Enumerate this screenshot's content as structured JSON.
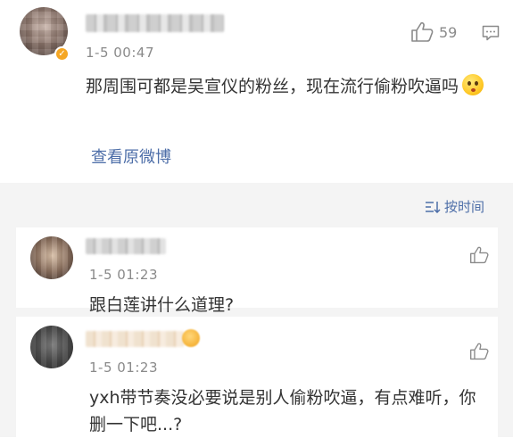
{
  "main_comment": {
    "time": "1-5 00:47",
    "like_count": "59",
    "content": "那周围可都是吴宣仪的粉丝，现在流行偷粉吹逼吗",
    "view_original": "查看原微博"
  },
  "replies_header": {
    "sort_label": "按时间"
  },
  "replies": [
    {
      "time": "1-5 01:23",
      "content": "跟白莲讲什么道理?"
    },
    {
      "time": "1-5 01:23",
      "content": "yxh带节奏没必要说是别人偷粉吹逼，有点难听，你删一下吧...?"
    }
  ],
  "colors": {
    "link_blue": "#4d6ea8",
    "meta_gray": "#8a8a8a",
    "replies_bg": "#f4f4f4",
    "badge_gold": "#f5a623"
  },
  "icons": [
    "thumbs-up-icon",
    "reply-icon",
    "sort-icon",
    "verified-badge-icon",
    "emoji-icon"
  ]
}
